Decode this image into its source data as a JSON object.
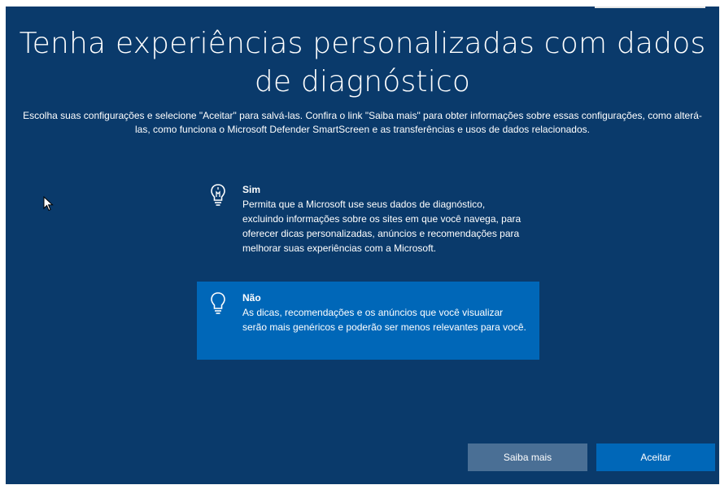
{
  "title": "Tenha experiências personalizadas com dados de diagnóstico",
  "subtitle": "Escolha suas configurações e selecione \"Aceitar\" para salvá-las. Confira o link \"Saiba mais\" para obter informações sobre essas configurações, como alterá-las, como funciona o Microsoft Defender SmartScreen e as transferências e usos de dados relacionados.",
  "options": [
    {
      "icon": "lightbulb-on-icon",
      "title": "Sim",
      "description": "Permita que a Microsoft use seus dados de diagnóstico, excluindo informações sobre os sites em que você navega, para oferecer dicas personalizadas, anúncios e recomendações para melhorar suas experiências com a Microsoft.",
      "selected": false
    },
    {
      "icon": "lightbulb-off-icon",
      "title": "Não",
      "description": "As dicas, recomendações e os anúncios que você visualizar serão mais genéricos e poderão ser menos relevantes para você.",
      "selected": true
    }
  ],
  "buttons": {
    "learn_more": "Saiba mais",
    "accept": "Aceitar"
  },
  "colors": {
    "background": "#0a3a6b",
    "selected": "#0067b8",
    "secondary_button": "#4a6f95",
    "primary_button": "#0067b8"
  }
}
